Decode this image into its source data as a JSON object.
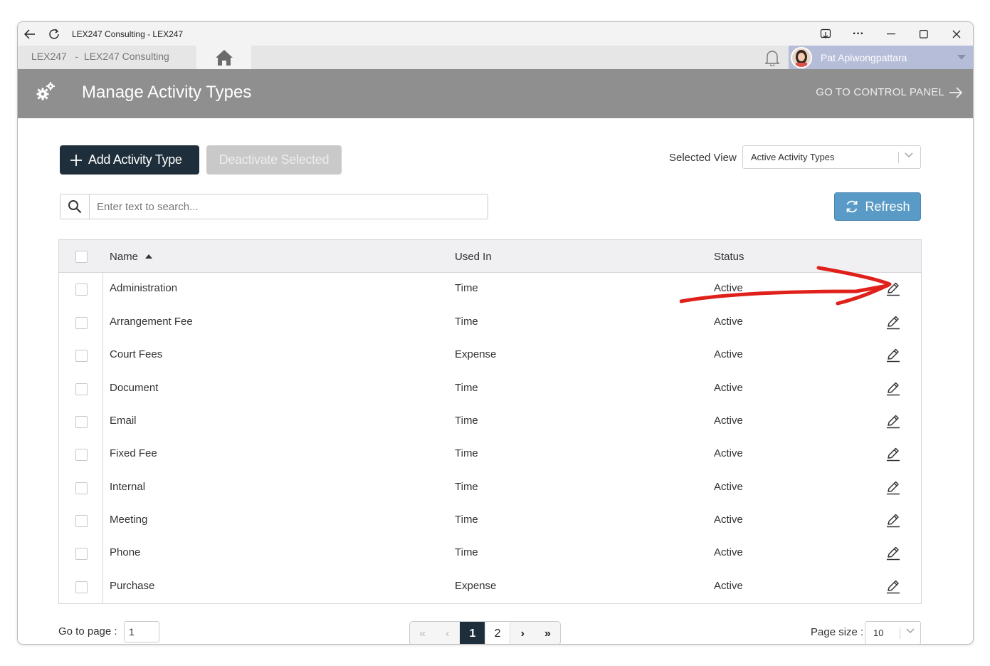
{
  "browser": {
    "title": "LEX247 Consulting - LEX247"
  },
  "appbar": {
    "breadcrumb": "LEX247   -  LEX247 Consulting",
    "user_name": "Pat Apiwongpattara"
  },
  "header": {
    "title": "Manage Activity Types",
    "control_panel_link": "GO TO CONTROL PANEL"
  },
  "toolbar": {
    "add_label": "Add Activity Type",
    "deactivate_label": "Deactivate Selected",
    "view_label": "Selected View",
    "view_value": "Active Activity Types",
    "search_placeholder": "Enter text to search...",
    "refresh_label": "Refresh"
  },
  "grid": {
    "columns": [
      "Name",
      "Used In",
      "Status"
    ],
    "sort": {
      "column": "Name",
      "direction": "ascending"
    },
    "rows": [
      {
        "name": "Administration",
        "used_in": "Time",
        "status": "Active"
      },
      {
        "name": "Arrangement Fee",
        "used_in": "Time",
        "status": "Active"
      },
      {
        "name": "Court Fees",
        "used_in": "Expense",
        "status": "Active"
      },
      {
        "name": "Document",
        "used_in": "Time",
        "status": "Active"
      },
      {
        "name": "Email",
        "used_in": "Time",
        "status": "Active"
      },
      {
        "name": "Fixed Fee",
        "used_in": "Time",
        "status": "Active"
      },
      {
        "name": "Internal",
        "used_in": "Time",
        "status": "Active"
      },
      {
        "name": "Meeting",
        "used_in": "Time",
        "status": "Active"
      },
      {
        "name": "Phone",
        "used_in": "Time",
        "status": "Active"
      },
      {
        "name": "Purchase",
        "used_in": "Expense",
        "status": "Active"
      }
    ]
  },
  "pager": {
    "goto_label": "Go to page :",
    "goto_value": "1",
    "pages": [
      "1",
      "2"
    ],
    "current_page": "1",
    "page_size_label": "Page size :",
    "page_size": "10"
  },
  "colors": {
    "header_band": "#8f8f8f",
    "primary_button": "#1e2f3b",
    "refresh_button": "#5a9ac6",
    "user_box": "#b6bdd8",
    "annotation_arrow": "#e0201b"
  }
}
